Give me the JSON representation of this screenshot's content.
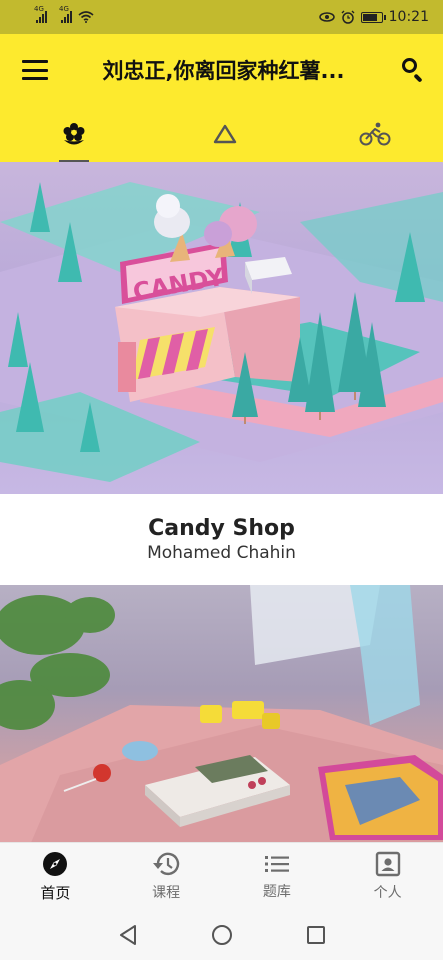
{
  "status_bar": {
    "signal_1_label": "4G",
    "signal_2_label": "4G",
    "time": "10:21",
    "icons": [
      "signal-icon",
      "signal-icon",
      "wifi-icon",
      "eye-comfort-icon",
      "alarm-icon",
      "battery-icon"
    ]
  },
  "header": {
    "title": "刘忠正,你离回家种红薯...",
    "background": "#fdea2e",
    "menu_icon": "hamburger-menu-icon",
    "search_icon": "search-icon"
  },
  "tabs": [
    {
      "icon": "flower-icon",
      "selected": true
    },
    {
      "icon": "triangle-icon",
      "selected": false
    },
    {
      "icon": "bicycle-icon",
      "selected": false
    }
  ],
  "cards": [
    {
      "title": "Candy Shop",
      "author": "Mohamed Chahin",
      "sign_text": "CANDY"
    },
    {
      "title": "",
      "author": ""
    }
  ],
  "bottom_nav": [
    {
      "label": "首页",
      "icon": "compass-icon",
      "active": true
    },
    {
      "label": "课程",
      "icon": "history-icon",
      "active": false
    },
    {
      "label": "题库",
      "icon": "list-icon",
      "active": false
    },
    {
      "label": "个人",
      "icon": "contact-icon",
      "active": false
    }
  ],
  "system_nav": {
    "icons": [
      "back-icon",
      "home-icon",
      "recents-icon"
    ]
  }
}
